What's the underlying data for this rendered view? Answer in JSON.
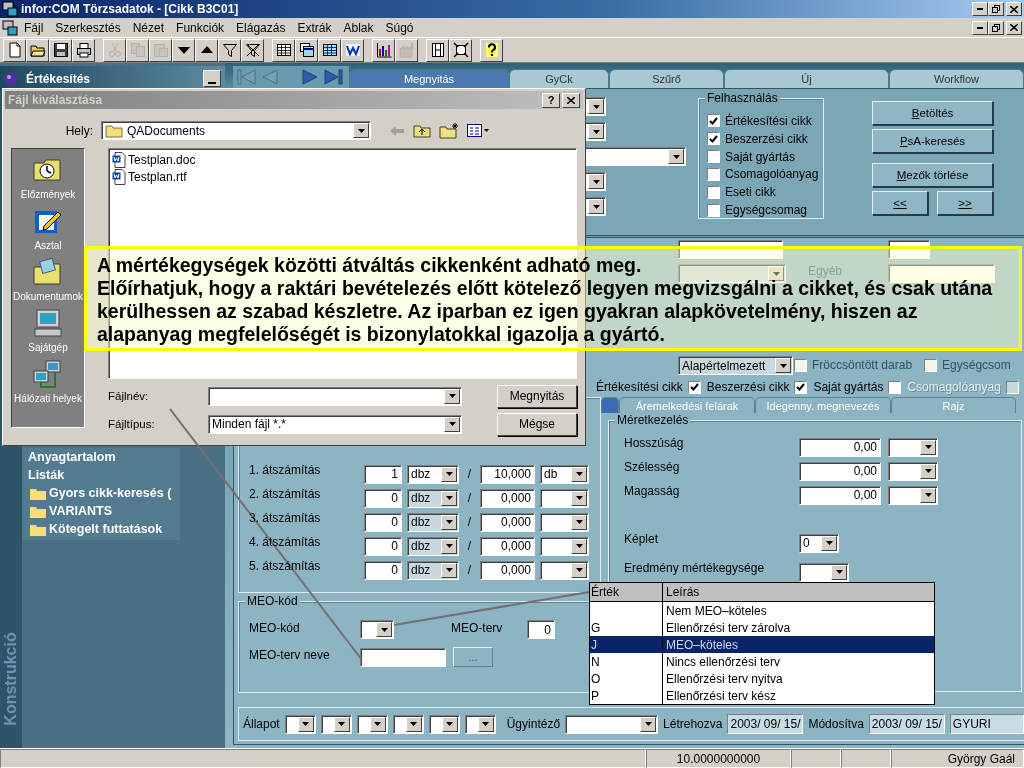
{
  "window": {
    "title": "infor:COM Törzsadatok - [Cikk B3C01]"
  },
  "menu": [
    "Fájl",
    "Szerkesztés",
    "Nézet",
    "Funkciók",
    "Elágazás",
    "Extrák",
    "Ablak",
    "Súgó"
  ],
  "toolbar": [
    [
      {
        "kind": "new",
        "disabled": false
      },
      {
        "kind": "open",
        "disabled": false
      },
      {
        "kind": "save",
        "disabled": false
      },
      {
        "kind": "print",
        "disabled": false
      }
    ],
    [
      {
        "kind": "cut",
        "disabled": true
      },
      {
        "kind": "copy",
        "disabled": true
      },
      {
        "kind": "paste",
        "disabled": true
      },
      {
        "kind": "down",
        "disabled": false
      },
      {
        "kind": "up",
        "disabled": false
      },
      {
        "kind": "filter",
        "disabled": false
      },
      {
        "kind": "filter_clear",
        "disabled": false
      }
    ],
    [
      {
        "kind": "table",
        "disabled": false
      },
      {
        "kind": "windows",
        "disabled": false
      },
      {
        "kind": "grid",
        "disabled": false
      },
      {
        "kind": "word",
        "disabled": false
      }
    ],
    [
      {
        "kind": "chart",
        "disabled": false
      },
      {
        "kind": "factory",
        "disabled": true
      }
    ],
    [
      {
        "kind": "film",
        "disabled": false
      },
      {
        "kind": "frame",
        "disabled": false
      }
    ],
    [
      {
        "kind": "help",
        "disabled": false
      }
    ]
  ],
  "left_panel": {
    "title": "Értékesítés",
    "items": [
      {
        "label": "Anyagtartalom",
        "kind": "item"
      },
      {
        "label": "Listák",
        "kind": "item"
      },
      {
        "label": "Gyors cikk-keresés (",
        "kind": "folder"
      },
      {
        "label": "VARIANTS",
        "kind": "folder"
      },
      {
        "label": "Kötegelt futtatások",
        "kind": "folder"
      }
    ],
    "vertical_label": "Konstrukció"
  },
  "tabs": [
    {
      "label": "Megnyitás",
      "selected": true
    },
    {
      "label": "GyCk",
      "selected": false
    },
    {
      "label": "Szűrő",
      "selected": false
    },
    {
      "label": "Új",
      "selected": false
    },
    {
      "label": "Workflow",
      "selected": false
    }
  ],
  "usage": {
    "title": "Felhasználás",
    "options": [
      {
        "label": "Értékesítési cikk",
        "checked": true
      },
      {
        "label": "Beszerzési cikk",
        "checked": true
      },
      {
        "label": "Saját gyártás",
        "checked": false
      },
      {
        "label": "Csomagolóanyag",
        "checked": false
      },
      {
        "label": "Eseti cikk",
        "checked": false
      },
      {
        "label": "Egységcsomag",
        "checked": false
      }
    ]
  },
  "action_buttons": [
    "Betöltés",
    "PsA-keresés",
    "Mezők törlése",
    "<<",
    ">>"
  ],
  "details": {
    "other_label": "Egyéb",
    "default_combo": "Alapértelmezett",
    "flags": [
      {
        "label": "Fröccsöntött darab",
        "checked": false
      },
      {
        "label": "Egységcsom",
        "checked": false
      }
    ]
  },
  "item_flags": [
    {
      "label": "Értékesítési cikk",
      "checked": true,
      "disabled": false
    },
    {
      "label": "Beszerzési cikk",
      "checked": true,
      "disabled": false
    },
    {
      "label": "Saját gyártás",
      "checked": false,
      "disabled": false
    },
    {
      "label": "Csomagolóanyag",
      "checked": false,
      "disabled": true
    }
  ],
  "inner_tabs": [
    {
      "selected": true
    },
    {
      "label": "Áremelkedési felárak",
      "selected": false
    },
    {
      "label": "Idegenny. megnevezés",
      "selected": false
    },
    {
      "label": "Rajz",
      "selected": false
    }
  ],
  "conversions": [
    {
      "label": "1. átszámítás",
      "qty": "1",
      "unit": "dbz",
      "unit_disabled": false,
      "separator": "/",
      "base_qty": "10,000",
      "base_unit": "db"
    },
    {
      "label": "2. átszámítás",
      "qty": "0",
      "unit": "dbz",
      "unit_disabled": true,
      "separator": "/",
      "base_qty": "0,000"
    },
    {
      "label": "3. átszámítás",
      "qty": "0",
      "unit": "dbz",
      "unit_disabled": true,
      "separator": "/",
      "base_qty": "0,000"
    },
    {
      "label": "4. átszámítás",
      "qty": "0",
      "unit": "dbz",
      "unit_disabled": true,
      "separator": "/",
      "base_qty": "0,000"
    },
    {
      "label": "5. átszámítás",
      "qty": "0",
      "unit": "dbz",
      "unit_disabled": true,
      "separator": "/",
      "base_qty": "0,000"
    }
  ],
  "meo": {
    "title": "MEO-kód",
    "code_label": "MEO-kód",
    "plan_label": "MEO-terv",
    "plan_value": "0",
    "plan_name_label": "MEO-terv neve",
    "browse_button": "..."
  },
  "dimensions": {
    "title": "Méretkezelés",
    "rows": [
      {
        "label": "Hosszúság",
        "value": "0,00"
      },
      {
        "label": "Szélesség",
        "value": "0,00"
      },
      {
        "label": "Magasság",
        "value": "0,00"
      }
    ],
    "formula_label": "Képlet",
    "formula_value": "0",
    "result_unit_label": "Eredmény mértékegysége"
  },
  "bottom_bar": {
    "status_label": "Állapot",
    "clerk_label": "Ügyintéző",
    "created_label": "Létrehozva",
    "created": "2003/ 09/ 15/",
    "modified_label": "Módosítva",
    "modified": "2003/ 09/ 15/",
    "user": "GYURI"
  },
  "status_bar": {
    "value": "10.0000000000",
    "user": "György Gaál"
  },
  "file_dialog": {
    "title": "Fájl kiválasztása",
    "help_button": "?",
    "location_label": "Hely:",
    "location": "QADocuments",
    "places": [
      {
        "label": "Előzmények",
        "kind": "history"
      },
      {
        "label": "Asztal",
        "kind": "desktop"
      },
      {
        "label": "Dokumentumok",
        "kind": "documents"
      },
      {
        "label": "Sajátgép",
        "kind": "computer"
      },
      {
        "label": "Hálózati helyek",
        "kind": "network"
      }
    ],
    "files": [
      {
        "name": "Testplan.doc"
      },
      {
        "name": "Testplan.rtf"
      }
    ],
    "filename_label": "Fájlnév:",
    "filetype_label": "Fájltípus:",
    "filetype": "Minden fájl *.*",
    "buttons": [
      "Megnyitás",
      "Mégse"
    ]
  },
  "value_list": {
    "columns": [
      "Érték",
      "Leírás"
    ],
    "rows": [
      {
        "description": "Nem MEO–köteles",
        "selected": false
      },
      {
        "value": "G",
        "description": "Ellenőrzési terv zárolva",
        "selected": false
      },
      {
        "value": "J",
        "description": "MEO–köteles",
        "selected": true
      },
      {
        "value": "N",
        "description": "Nincs ellenőrzési terv",
        "selected": false
      },
      {
        "value": "O",
        "description": "Ellenőrzési terv nyitva",
        "selected": false
      },
      {
        "value": "P",
        "description": "Ellenőrzési terv kész",
        "selected": false
      }
    ]
  },
  "callout": {
    "paragraphs": [
      "A mértékegységek közötti átváltás cikkenként adható meg.",
      "Előírhatjuk, hogy a raktári bevételezés előtt kötelező legyen megvizsgálni a cikket, és csak utána kerülhessen az szabad készletre. Az iparban ez igen gyakran alapkövetelmény, hiszen az alapanyag megfelelőségét is bizonylatokkal igazolja a gyártó."
    ]
  }
}
